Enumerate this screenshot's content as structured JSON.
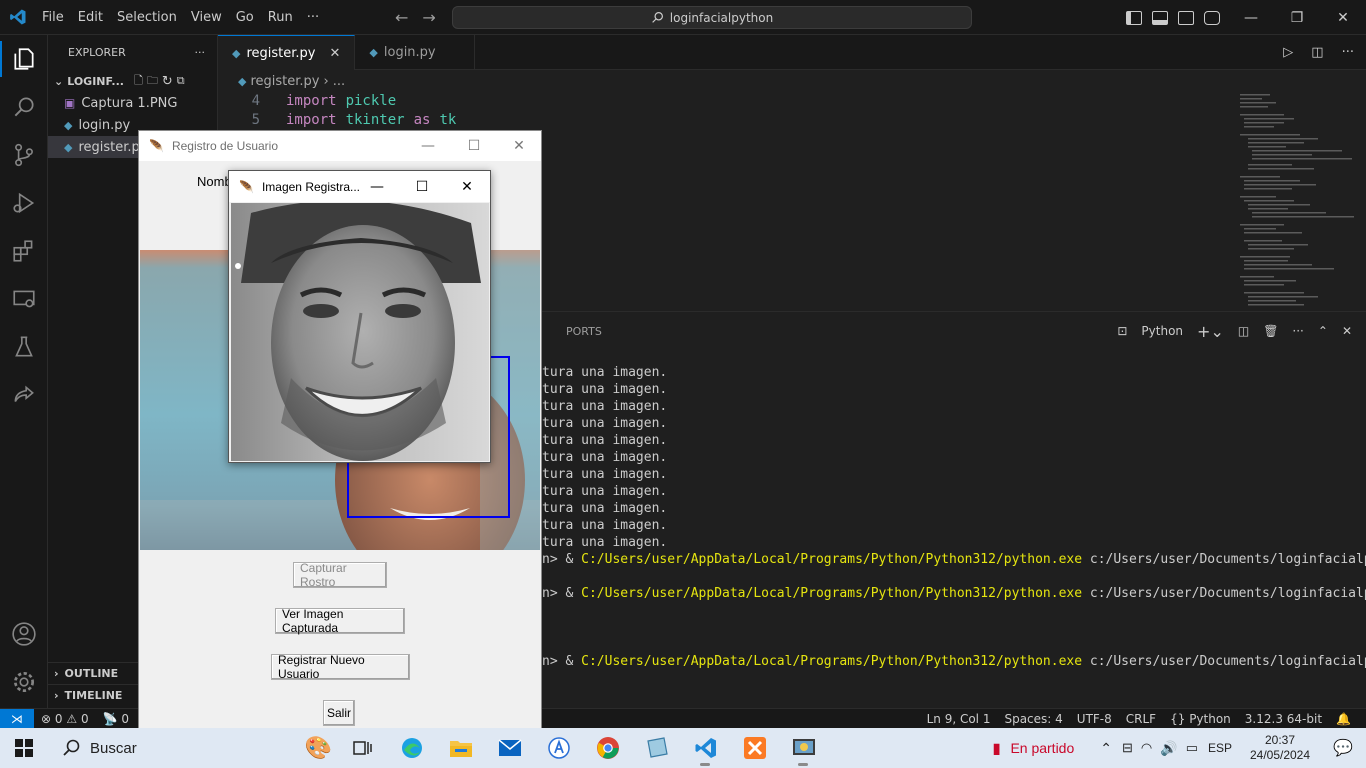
{
  "titlebar": {
    "menu": [
      "File",
      "Edit",
      "Selection",
      "View",
      "Go",
      "Run",
      "···"
    ],
    "search_text": "loginfacialpython"
  },
  "sidebar": {
    "header": "EXPLORER",
    "header_more": "···",
    "folder": "LOGINF...",
    "files": [
      {
        "name": "Captura 1.PNG",
        "type": "image"
      },
      {
        "name": "login.py",
        "type": "python"
      },
      {
        "name": "register.py",
        "type": "python",
        "selected": true
      }
    ],
    "outline": "OUTLINE",
    "timeline": "TIMELINE"
  },
  "editor": {
    "tabs": [
      {
        "label": "register.py",
        "active": true
      },
      {
        "label": "login.py",
        "active": false
      }
    ],
    "breadcrumb_file": "register.py",
    "breadcrumb_rest": "...",
    "code_lines": [
      {
        "num": "4",
        "keyword": "import",
        "rest": "pickle"
      },
      {
        "num": "5",
        "keyword": "import",
        "rest": "tkinter",
        "as": "as",
        "alias": "tk"
      }
    ]
  },
  "panel": {
    "tab_ports": "PORTS",
    "terminal_label": "Python",
    "terminal_lines": [
      {
        "text": "tura una imagen."
      },
      {
        "text": "tura una imagen."
      },
      {
        "text": "tura una imagen."
      },
      {
        "text": "tura una imagen."
      },
      {
        "text": "tura una imagen."
      },
      {
        "text": "tura una imagen."
      },
      {
        "text": "tura una imagen."
      },
      {
        "text": "tura una imagen."
      },
      {
        "text": "tura una imagen."
      },
      {
        "text": "tura una imagen."
      },
      {
        "text": "tura una imagen."
      },
      {
        "text": "n> & ",
        "path": "C:/Users/user/AppData/Local/Programs/Python/Python312/python.exe",
        "arg": " c:/Users/user/Documents/loginfacialpython/reg"
      },
      {
        "text": ""
      },
      {
        "text": "n> & ",
        "path": "C:/Users/user/AppData/Local/Programs/Python/Python312/python.exe",
        "arg": " c:/Users/user/Documents/loginfacialpython/reg"
      },
      {
        "text": ""
      },
      {
        "text": ""
      },
      {
        "text": ""
      },
      {
        "text": "n> & ",
        "path": "C:/Users/user/AppData/Local/Programs/Python/Python312/python.exe",
        "arg": " c:/Users/user/Documents/loginfacialpython/reg"
      }
    ]
  },
  "statusbar": {
    "errors": "0",
    "warnings": "0",
    "ports": "0",
    "position": "Ln 9, Col 1",
    "spaces": "Spaces: 4",
    "encoding": "UTF-8",
    "eol": "CRLF",
    "language": "Python",
    "interpreter": "3.12.3 64-bit"
  },
  "tk_main": {
    "title": "Registro de Usuario",
    "nombre_label": "Nomb",
    "buttons": {
      "capturar": "Capturar Rostro",
      "ver": "Ver Imagen Capturada",
      "registrar": "Registrar Nuevo Usuario",
      "salir": "Salir"
    }
  },
  "tk_image": {
    "title": "Imagen Registra..."
  },
  "taskbar": {
    "search_label": "Buscar",
    "tray_text": "En partido",
    "language": "ESP",
    "time": "20:37",
    "date": "24/05/2024"
  },
  "colors": {
    "accent": "#0078d4",
    "terminal_path": "#e5e510",
    "keyword": "#c586c0",
    "module": "#4ec9b0"
  }
}
